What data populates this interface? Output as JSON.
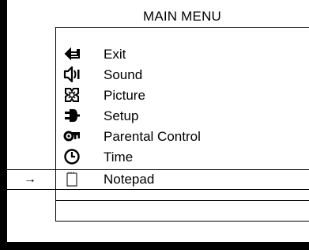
{
  "menu": {
    "title": "MAIN MENU",
    "selected_marker": "→",
    "items": [
      {
        "label": "Exit",
        "icon": "return-arrow-icon"
      },
      {
        "label": "Sound",
        "icon": "speaker-icon"
      },
      {
        "label": "Picture",
        "icon": "picture-icon"
      },
      {
        "label": "Setup",
        "icon": "plug-icon"
      },
      {
        "label": "Parental Control",
        "icon": "key-icon"
      },
      {
        "label": "Time",
        "icon": "clock-icon"
      },
      {
        "label": "Notepad",
        "icon": "notepad-icon"
      }
    ],
    "selected_index": 6
  }
}
